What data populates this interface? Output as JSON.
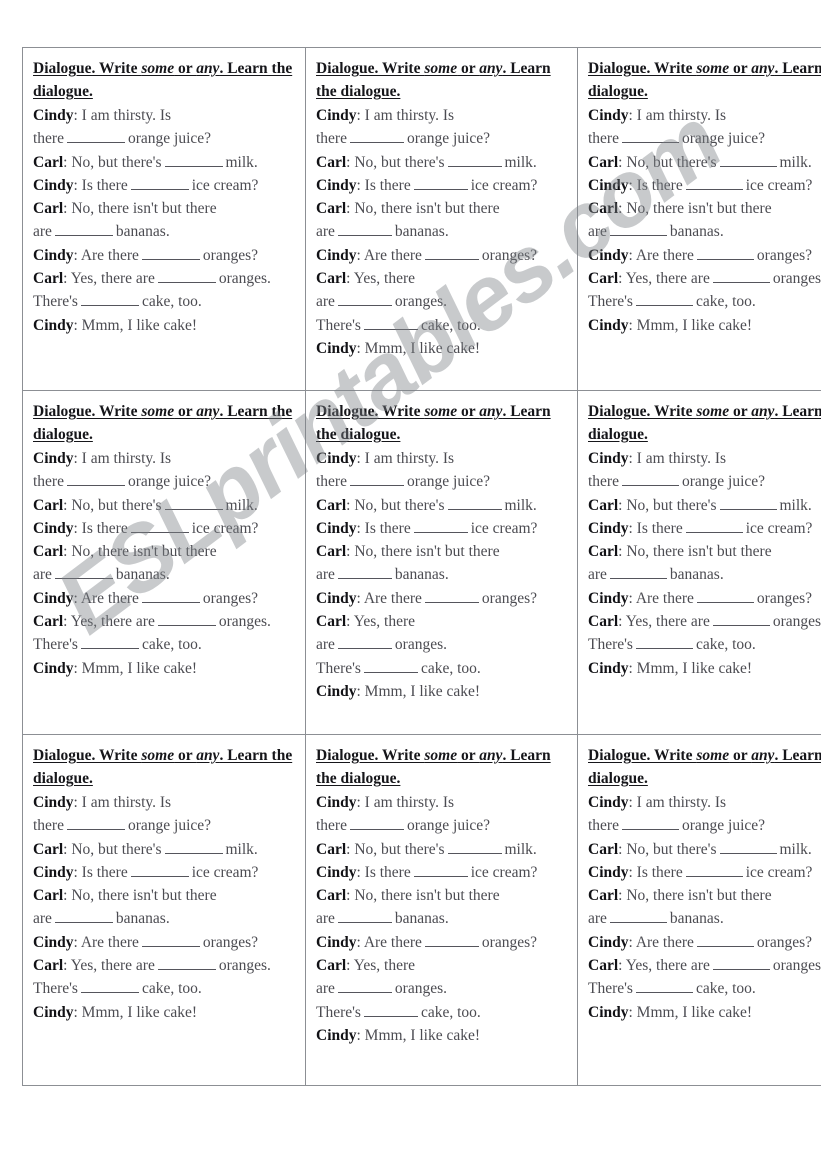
{
  "document": {
    "type": "ESL worksheet",
    "watermark": "ESLprintables.com",
    "grid": {
      "rows": 3,
      "columns": 3,
      "total_cards": 9
    }
  },
  "card": {
    "heading": {
      "part1": "Dialogue. Write ",
      "em1": "some",
      "part2": " or ",
      "em2": "any",
      "part3": ". Learn the dialogue."
    },
    "speakers": {
      "cindy": "Cindy",
      "carl": "Carl"
    },
    "lines": {
      "l1_a": ": I am thirsty. Is",
      "l1_b": "there",
      "l1_c": "orange juice?",
      "l2_a": ": No, but there's",
      "l2_b": "milk.",
      "l3_a": ": Is there",
      "l3_b": "ice cream?",
      "l4_a": ": No, there isn't but there",
      "l4_b": "are",
      "l4_c": "bananas.",
      "l5_a": ": Are there",
      "l5_b": "oranges?",
      "l6_a": ": Yes, there are",
      "l6_b": "oranges.",
      "l6_split_a": ": Yes, there",
      "l6_split_b": "are",
      "l6_split_c": "oranges.",
      "l7_a": "There's",
      "l7_b": "cake, too.",
      "l8_a": ": Mmm, I like cake!"
    }
  },
  "colors": {
    "border": "#8c8f94",
    "heading_text": "#16161a",
    "body_text": "#4c4c52",
    "watermark": "#7d8085",
    "page_background": "#ffffff"
  }
}
